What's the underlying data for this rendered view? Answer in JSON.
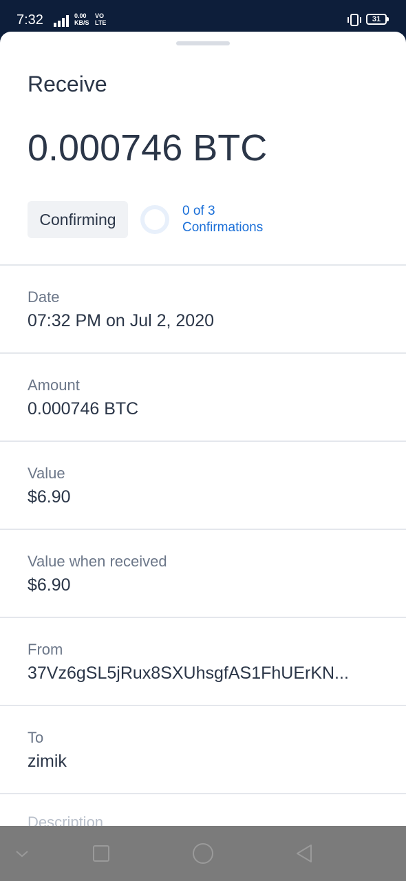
{
  "status_bar": {
    "time": "7:32",
    "signal": "4G",
    "speed_value": "0.00",
    "speed_unit": "KB/S",
    "network_1": "VO",
    "network_2": "LTE",
    "battery": "31",
    "text_color": "#ffffff",
    "background_color": "#0d1e3a"
  },
  "sheet": {
    "title": "Receive",
    "amount": "0.000746 BTC",
    "status_chip": "Confirming",
    "confirmations_line1": "0 of 3",
    "confirmations_line2": "Confirmations",
    "confirmations_done": 0,
    "confirmations_required": 3,
    "accent_color": "#1a6fd8"
  },
  "details": [
    {
      "label": "Date",
      "value": "07:32 PM on Jul 2, 2020"
    },
    {
      "label": "Amount",
      "value": "0.000746 BTC"
    },
    {
      "label": "Value",
      "value": "$6.90"
    },
    {
      "label": "Value when received",
      "value": "$6.90"
    },
    {
      "label": "From",
      "value": "37Vz6gSL5jRux8SXUhsgfAS1FhUErKN..."
    },
    {
      "label": "To",
      "value": "zimik"
    }
  ],
  "partial_label": "Description",
  "nav_bar": {
    "icons": [
      "chevron-down-icon",
      "square-icon",
      "circle-icon",
      "triangle-back-icon"
    ]
  }
}
